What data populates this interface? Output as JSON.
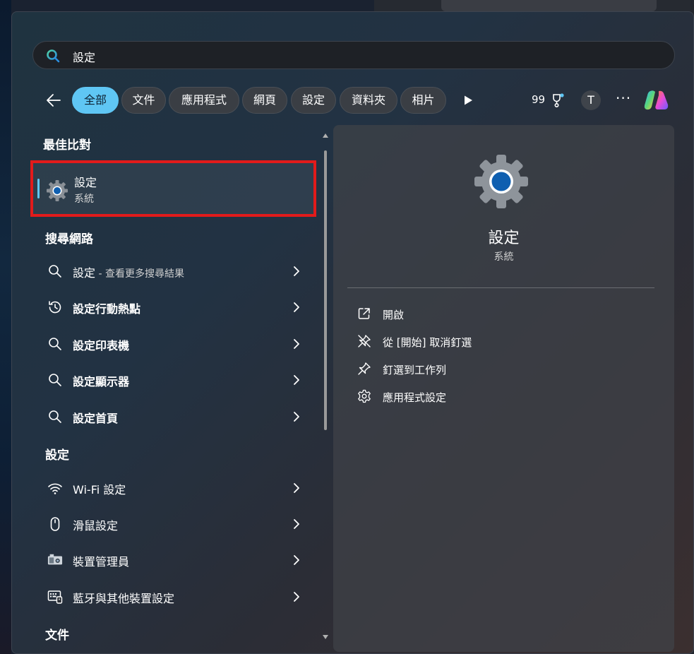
{
  "search": {
    "query": "設定"
  },
  "filters": {
    "chips": [
      "全部",
      "文件",
      "應用程式",
      "網頁",
      "設定",
      "資料夾",
      "相片"
    ],
    "points": "99",
    "avatar_initial": "T",
    "more": "···"
  },
  "best_match": {
    "heading": "最佳比對",
    "name": "設定",
    "subtitle": "系統"
  },
  "web_search": {
    "heading": "搜尋網路",
    "items": [
      {
        "label": "設定",
        "suffix": " - 查看更多搜尋結果",
        "icon": "search-icon"
      },
      {
        "label": "設定行動熱點",
        "icon": "history-icon"
      },
      {
        "label": "設定印表機",
        "icon": "search-icon"
      },
      {
        "label": "設定顯示器",
        "icon": "search-icon"
      },
      {
        "label": "設定首頁",
        "icon": "search-icon"
      }
    ]
  },
  "settings": {
    "heading": "設定",
    "items": [
      {
        "label": "Wi-Fi 設定",
        "icon": "wifi-icon"
      },
      {
        "label": "滑鼠設定",
        "icon": "mouse-icon"
      },
      {
        "label": "裝置管理員",
        "icon": "device-manager-icon"
      },
      {
        "label": "藍牙與其他裝置設定",
        "icon": "bluetooth-devices-icon"
      }
    ]
  },
  "documents": {
    "heading": "文件"
  },
  "detail": {
    "name": "設定",
    "subtitle": "系統",
    "actions": [
      {
        "label": "開啟",
        "icon": "open-icon"
      },
      {
        "label": "從 [開始] 取消釘選",
        "icon": "unpin-icon"
      },
      {
        "label": "釘選到工作列",
        "icon": "pin-icon"
      },
      {
        "label": "應用程式設定",
        "icon": "gear-icon"
      }
    ]
  },
  "colors": {
    "accent": "#5fc6f4",
    "highlight_border": "#e21b1b",
    "gear_blue": "#0f5fb0"
  }
}
